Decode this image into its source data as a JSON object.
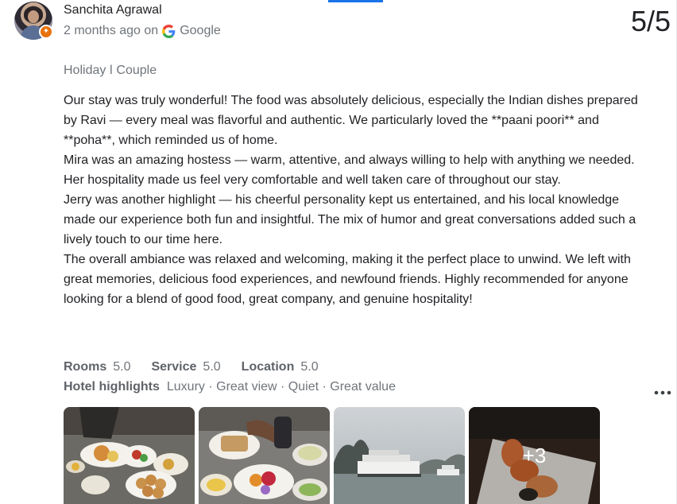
{
  "reviewer": {
    "name": "Sanchita Agrawal",
    "time_ago": "2 months ago on",
    "source": "Google"
  },
  "review_counter": "5/5",
  "trip_tags": "Holiday ǀ Couple",
  "review_paragraphs": [
    "Our stay was truly wonderful! The food was absolutely delicious, especially the Indian dishes prepared by Ravi — every meal was flavorful and authentic. We particularly loved the **paani poori** and **poha**, which reminded us of home.",
    "Mira was an amazing hostess — warm, attentive, and always willing to help with anything we needed. Her hospitality made us feel very comfortable and well taken care of throughout our stay.",
    "Jerry was another highlight — his cheerful personality kept us entertained, and his local knowledge made our experience both fun and insightful. The mix of humor and great conversations added such a lively touch to our time here.",
    "The overall ambiance was relaxed and welcoming, making it the perfect place to unwind. We left with great memories, delicious food experiences, and newfound friends. Highly recommended for anyone looking for a blend of good food, great company, and genuine hospitality!"
  ],
  "ratings": [
    {
      "label": "Rooms",
      "value": "5.0"
    },
    {
      "label": "Service",
      "value": "5.0"
    },
    {
      "label": "Location",
      "value": "5.0"
    }
  ],
  "highlights": {
    "label": "Hotel highlights",
    "value": "Luxury · Great view · Quiet · Great value"
  },
  "photos": {
    "more_count": "+3"
  },
  "icons": {
    "avatar_badge": "local-guide-badge",
    "source": "google-g-icon",
    "more": "more-options-icon"
  },
  "colors": {
    "accent": "#1a73e8",
    "badge": "#e8710a",
    "secondary_text": "#70757a"
  }
}
